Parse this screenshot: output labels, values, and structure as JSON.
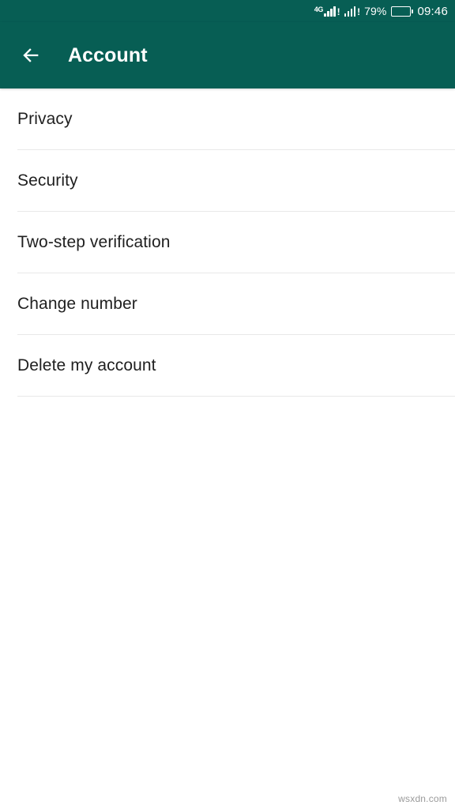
{
  "status_bar": {
    "network_label": "4G",
    "sim1_alert": "!",
    "sim2_alert": "!",
    "battery_percent": "79%",
    "battery_level": 79,
    "clock": "09:46"
  },
  "app_bar": {
    "back_icon": "arrow-left-icon",
    "title": "Account"
  },
  "list": {
    "items": [
      {
        "label": "Privacy"
      },
      {
        "label": "Security"
      },
      {
        "label": "Two-step verification"
      },
      {
        "label": "Change number"
      },
      {
        "label": "Delete my account"
      }
    ]
  },
  "watermark": {
    "text": "wsxdn.com"
  },
  "colors": {
    "header": "#075e54",
    "page_background": "#ffffff",
    "divider": "#e8e8e8",
    "text_primary": "#1f1f1f",
    "text_on_header": "#ffffff"
  }
}
